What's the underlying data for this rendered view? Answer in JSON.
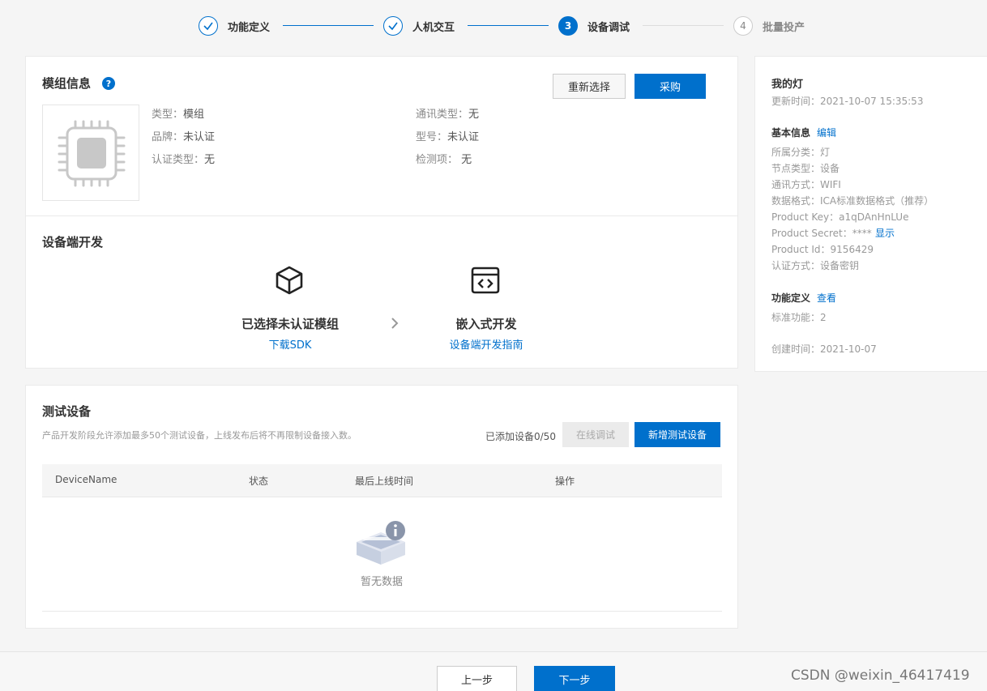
{
  "stepper": {
    "steps": [
      {
        "label": "功能定义",
        "state": "done"
      },
      {
        "label": "人机交互",
        "state": "done"
      },
      {
        "label": "设备调试",
        "state": "active",
        "number": "3"
      },
      {
        "label": "批量投产",
        "state": "todo",
        "number": "4"
      }
    ]
  },
  "module": {
    "title": "模组信息",
    "reselect_label": "重新选择",
    "purchase_label": "采购",
    "fields": {
      "type_label": "类型：",
      "type_value": "模组",
      "brand_label": "品牌：",
      "brand_value": "未认证",
      "cert_type_label": "认证类型：",
      "cert_type_value": "无",
      "comm_type_label": "通讯类型：",
      "comm_type_value": "无",
      "model_label": "型号：",
      "model_value": "未认证",
      "check_label": "检测项：",
      "check_value": "无"
    }
  },
  "device_dev": {
    "title": "设备端开发",
    "left_title": "已选择未认证模组",
    "left_link": "下载SDK",
    "right_title": "嵌入式开发",
    "right_link": "设备端开发指南"
  },
  "test_devices": {
    "title": "测试设备",
    "subtitle": "产品开发阶段允许添加最多50个测试设备，上线发布后将不再限制设备接入数。",
    "count_text": "已添加设备0/50",
    "online_debug_label": "在线调试",
    "add_label": "新增测试设备",
    "columns": [
      "DeviceName",
      "状态",
      "最后上线时间",
      "操作"
    ],
    "empty_text": "暂无数据"
  },
  "sidebar": {
    "product_name": "我的灯",
    "updated": "更新时间：2021-10-07 15:35:53",
    "basic_title": "基本信息",
    "edit_label": "编辑",
    "lines": [
      "所属分类：灯",
      "节点类型：设备",
      "通讯方式：WIFI",
      "数据格式：ICA标准数据格式（推荐）",
      "Product Key：a1qDAnHnLUe"
    ],
    "secret_text": "Product Secret：****",
    "show_label": "显示",
    "lines2": [
      "Product Id：9156429",
      "认证方式：设备密钥"
    ],
    "func_title": "功能定义",
    "view_label": "查看",
    "std_func": "标准功能：2",
    "created": "创建时间：2021-10-07"
  },
  "footer": {
    "prev_label": "上一步",
    "next_label": "下一步",
    "watermark": "CSDN @weixin_46417419"
  },
  "colors": {
    "primary": "#0070cc",
    "background": "#f5f5f5"
  }
}
